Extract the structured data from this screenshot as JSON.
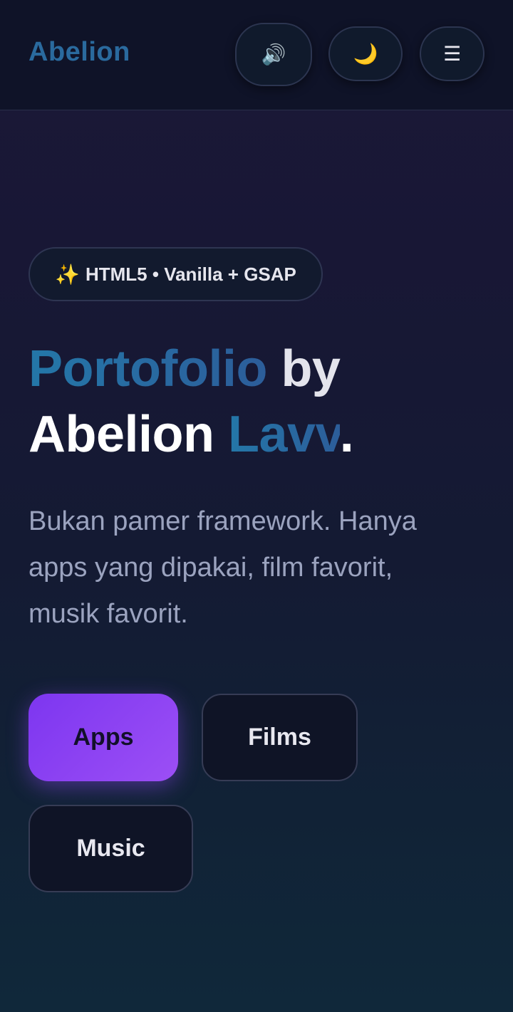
{
  "header": {
    "brand": "Abelion",
    "sound_icon": "🔊",
    "theme_icon": "🌙",
    "menu_icon": "☰"
  },
  "hero": {
    "badge_icon": "✨",
    "badge_text": "HTML5 • Vanilla + GSAP",
    "title_part1": "Portofolio",
    "title_part2": " by",
    "title_part3": "Abelion ",
    "title_part4": "Lavv",
    "title_part5": ".",
    "description": "Bukan pamer framework. Hanya apps yang dipakai, film favorit, musik favorit."
  },
  "filters": {
    "apps": "Apps",
    "films": "Films",
    "music": "Music"
  },
  "colors": {
    "accent_purple": "#8b3ff2",
    "accent_blue": "#2a6a9e",
    "background": "#181735"
  }
}
